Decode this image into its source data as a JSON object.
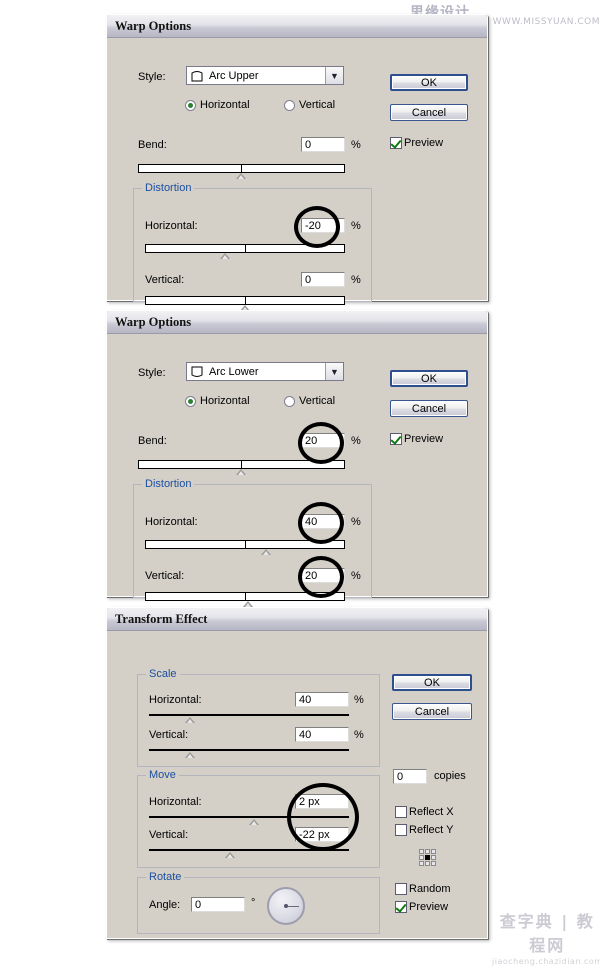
{
  "watermarks": {
    "top_cn": "思缘设计论坛",
    "top_en": "WWW.MISSYUAN.COM",
    "bottom_cn": "查字典 | 教程网",
    "bottom_en": "jiaocheng.chazidian.com"
  },
  "common": {
    "ok": "OK",
    "cancel": "Cancel",
    "preview": "Preview",
    "horizontal": "Horizontal",
    "vertical": "Vertical",
    "percent": "%",
    "degree": "°",
    "style_label": "Style:",
    "bend_label": "Bend:",
    "distortion_label": "Distortion",
    "horizontal_label": "Horizontal:",
    "vertical_label": "Vertical:",
    "dropdown_arrow": "chevron-down-icon"
  },
  "dialogs": [
    {
      "id": "warp-options-1",
      "title": "Warp Options",
      "style_value": "Arc Upper",
      "style_icon": "arc-upper-icon",
      "orientation": "Horizontal",
      "bend": {
        "label": "Bend:",
        "value": "0",
        "unit": "%",
        "thumb_pct": 50
      },
      "distortion": {
        "label": "Distortion",
        "horizontal": {
          "label": "Horizontal:",
          "value": "-20",
          "unit": "%",
          "thumb_pct": 40,
          "marked": true
        },
        "vertical": {
          "label": "Vertical:",
          "value": "0",
          "unit": "%",
          "thumb_pct": 50,
          "marked": false
        }
      },
      "buttons": {
        "ok": "OK",
        "cancel": "Cancel"
      },
      "preview": {
        "label": "Preview",
        "checked": true
      }
    },
    {
      "id": "warp-options-2",
      "title": "Warp Options",
      "style_value": "Arc Lower",
      "style_icon": "arc-lower-icon",
      "orientation": "Horizontal",
      "bend": {
        "label": "Bend:",
        "value": "20",
        "unit": "%",
        "thumb_pct": 50,
        "marked": true
      },
      "distortion": {
        "label": "Distortion",
        "horizontal": {
          "label": "Horizontal:",
          "value": "40",
          "unit": "%",
          "thumb_pct": 60,
          "marked": true
        },
        "vertical": {
          "label": "Vertical:",
          "value": "20",
          "unit": "%",
          "thumb_pct": 52,
          "marked": true
        }
      },
      "buttons": {
        "ok": "OK",
        "cancel": "Cancel"
      },
      "preview": {
        "label": "Preview",
        "checked": true
      }
    }
  ],
  "transform": {
    "id": "transform-effect",
    "title": "Transform Effect",
    "scale": {
      "label": "Scale",
      "horizontal": {
        "label": "Horizontal:",
        "value": "40",
        "unit": "%",
        "thumb_pct": 20
      },
      "vertical": {
        "label": "Vertical:",
        "value": "40",
        "unit": "%",
        "thumb_pct": 20
      }
    },
    "move": {
      "label": "Move",
      "horizontal": {
        "label": "Horizontal:",
        "value": "2 px",
        "thumb_pct": 52,
        "marked": true
      },
      "vertical": {
        "label": "Vertical:",
        "value": "-22 px",
        "thumb_pct": 40,
        "marked": true
      }
    },
    "rotate": {
      "label": "Rotate",
      "angle_label": "Angle:",
      "angle_value": "0",
      "unit": "°"
    },
    "buttons": {
      "ok": "OK",
      "cancel": "Cancel"
    },
    "copies": {
      "value": "0",
      "label": "copies"
    },
    "reflect_x": {
      "label": "Reflect X",
      "checked": false
    },
    "reflect_y": {
      "label": "Reflect Y",
      "checked": false
    },
    "reference_point": "reference-point-grid-icon",
    "random": {
      "label": "Random",
      "checked": false
    },
    "preview": {
      "label": "Preview",
      "checked": true
    }
  }
}
